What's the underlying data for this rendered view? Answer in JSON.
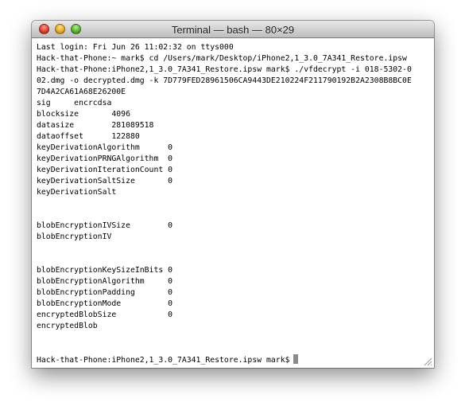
{
  "window": {
    "title": "Terminal — bash — 80×29"
  },
  "terminal": {
    "lines": [
      "Last login: Fri Jun 26 11:02:32 on ttys000",
      "Hack-that-Phone:~ mark$ cd /Users/mark/Desktop/iPhone2,1_3.0_7A341_Restore.ipsw",
      "Hack-that-Phone:iPhone2,1_3.0_7A341_Restore.ipsw mark$ ./vfdecrypt -i 018-5302-0",
      "02.dmg -o decrypted.dmg -k 7D779FED28961506CA9443DE210224F211790192B2A2308B8BC0E",
      "7D4A2CA61A68E26200E",
      "sig     encrcdsa",
      "blocksize       4096",
      "datasize        281089518",
      "dataoffset      122880",
      "keyDerivationAlgorithm      0",
      "keyDerivationPRNGAlgorithm  0",
      "keyDerivationIterationCount 0",
      "keyDerivationSaltSize       0",
      "keyDerivationSalt",
      "",
      "",
      "blobEncryptionIVSize        0",
      "blobEncryptionIV",
      "",
      "",
      "blobEncryptionKeySizeInBits 0",
      "blobEncryptionAlgorithm     0",
      "blobEncryptionPadding       0",
      "blobEncryptionMode          0",
      "encryptedBlobSize           0",
      "encryptedBlob",
      "",
      ""
    ],
    "prompt": "Hack-that-Phone:iPhone2,1_3.0_7A341_Restore.ipsw mark$"
  },
  "icons": {
    "close": "close-button",
    "minimize": "minimize-button",
    "zoom": "zoom-button",
    "resize": "resize-grip-icon"
  },
  "colors": {
    "close": "#d83a2a",
    "minimize": "#e0a41c",
    "zoom": "#53ac2e",
    "background": "#ffffff",
    "text": "#000000",
    "cursor": "#8a8a8a"
  }
}
